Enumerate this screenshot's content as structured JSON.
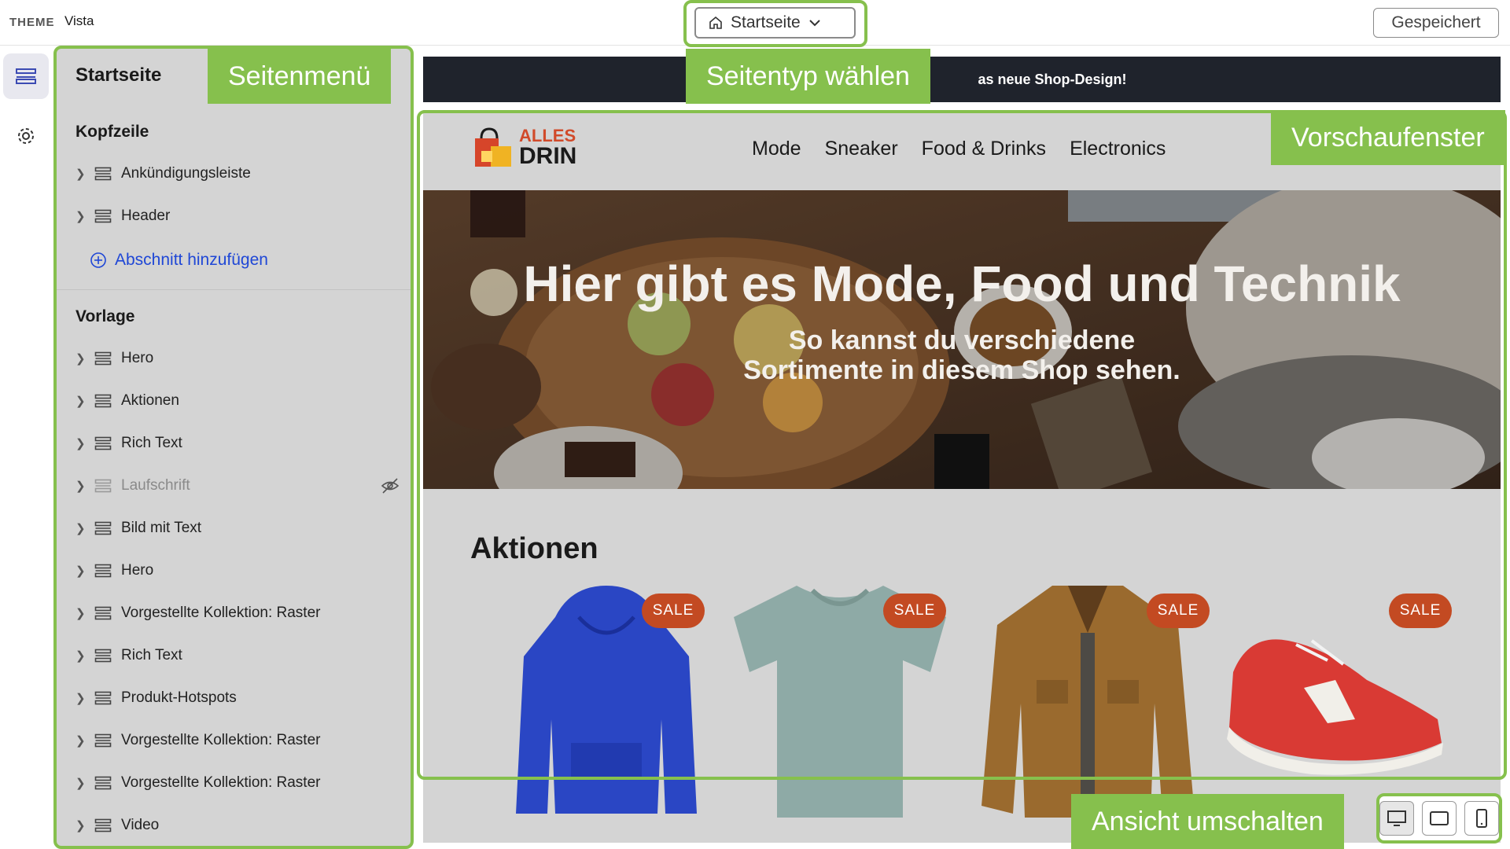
{
  "topbar": {
    "theme_label": "THEME",
    "theme_name": "Vista",
    "page_select": "Startseite",
    "saved": "Gespeichert"
  },
  "sidebar": {
    "title": "Startseite",
    "header_section": {
      "title": "Kopfzeile",
      "items": [
        {
          "label": "Ankündigungsleiste"
        },
        {
          "label": "Header"
        }
      ],
      "add_label": "Abschnitt hinzufügen"
    },
    "template_section": {
      "title": "Vorlage",
      "items": [
        {
          "label": "Hero"
        },
        {
          "label": "Aktionen"
        },
        {
          "label": "Rich Text"
        },
        {
          "label": "Laufschrift",
          "hidden": true
        },
        {
          "label": "Bild mit Text"
        },
        {
          "label": "Hero"
        },
        {
          "label": "Vorgestellte Kollektion: Raster"
        },
        {
          "label": "Rich Text"
        },
        {
          "label": "Produkt-Hotspots"
        },
        {
          "label": "Vorgestellte Kollektion: Raster"
        },
        {
          "label": "Vorgestellte Kollektion: Raster"
        },
        {
          "label": "Video"
        }
      ]
    }
  },
  "preview": {
    "announcement": "as neue Shop-Design!",
    "logo": {
      "line1": "ALLES",
      "line2": "DRIN"
    },
    "nav": [
      "Mode",
      "Sneaker",
      "Food & Drinks",
      "Electronics"
    ],
    "hero": {
      "title": "Hier gibt es Mode, Food und Technik",
      "subtitle_line1": "So kannst du verschiedene",
      "subtitle_line2": "Sortimente in diesem Shop sehen."
    },
    "section_title": "Aktionen",
    "products": [
      {
        "badge": "SALE",
        "name": "hoodie"
      },
      {
        "badge": "SALE",
        "name": "t-shirt"
      },
      {
        "badge": "SALE",
        "name": "jacket"
      },
      {
        "badge": "SALE",
        "name": "sneaker"
      }
    ]
  },
  "callouts": {
    "sidebar": "Seitenmenü",
    "page_type": "Seitentyp wählen",
    "preview": "Vorschaufenster",
    "view": "Ansicht umschalten"
  },
  "colors": {
    "accent": "#86c04d",
    "sale": "#c34a22",
    "link": "#1f47d6"
  }
}
